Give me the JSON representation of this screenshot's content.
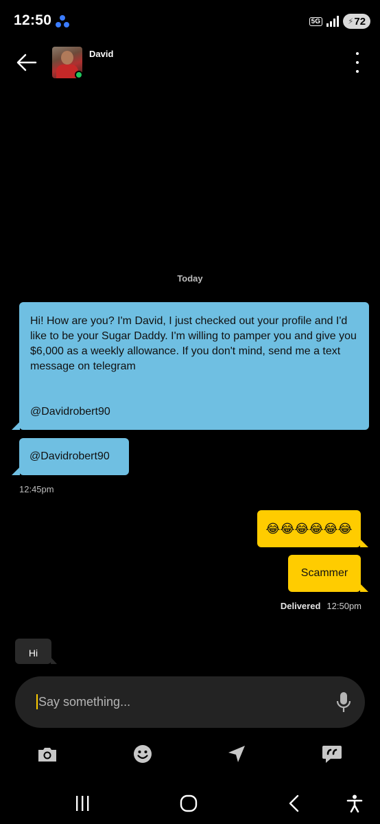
{
  "status_bar": {
    "time": "12:50",
    "network": "5G",
    "battery": "72",
    "app_icon": "people-icon"
  },
  "header": {
    "contact_name": "David",
    "online": true,
    "back_icon": "arrow-left-icon",
    "menu_icon": "more-vertical-icon"
  },
  "conversation": {
    "date_divider": "Today",
    "messages": [
      {
        "direction": "incoming",
        "text": "Hi! How are you? I'm David, I just checked out your profile and I'd like to be your Sugar Daddy. I'm willing to pamper you and give you $6,000 as a weekly allowance. If you don't mind, send me a text message on telegram",
        "handle": "@Davidrobert90"
      },
      {
        "direction": "incoming",
        "text": "@Davidrobert90"
      },
      {
        "direction": "outgoing",
        "text": "😂😂😂😂😂😂"
      },
      {
        "direction": "outgoing",
        "text": "Scammer"
      },
      {
        "direction": "incoming",
        "text": "Hi"
      }
    ],
    "incoming_timestamp": "12:45pm",
    "delivery_status": "Delivered",
    "outgoing_timestamp": "12:50pm"
  },
  "composer": {
    "placeholder": "Say something...",
    "value": "",
    "mic_icon": "microphone-icon"
  },
  "actions": {
    "camera_icon": "camera-icon",
    "emoji_icon": "smiley-icon",
    "location_icon": "location-arrow-icon",
    "phrases_icon": "quick-reply-icon"
  },
  "nav": {
    "recents_icon": "recents-icon",
    "home_icon": "home-icon",
    "back_icon": "back-icon",
    "accessibility_icon": "accessibility-icon"
  },
  "colors": {
    "background": "#000000",
    "incoming_bubble": "#6fbfe2",
    "outgoing_bubble": "#ffcc00",
    "incoming_dark_bubble": "#2a2a2a",
    "online_indicator": "#22c55e",
    "cursor": "#ffcc00"
  }
}
